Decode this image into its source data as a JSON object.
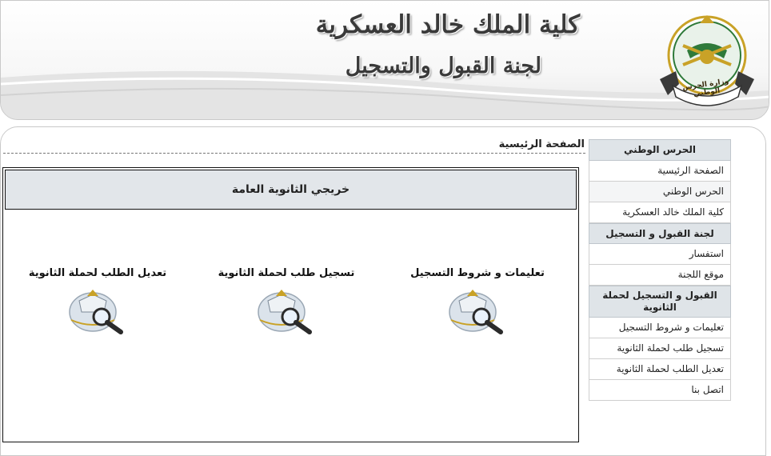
{
  "header": {
    "college_name": "كلية الملك خالد العسكرية",
    "committee_name": "لجنة القبول والتسجيل",
    "emblem_label": "وزارة الحرس الوطني"
  },
  "breadcrumb": "الصفحة الرئيسية",
  "sidebar": {
    "groups": [
      {
        "title": "الحرس الوطني",
        "items": [
          "الصفحة الرئيسية",
          "الحرس الوطني",
          "كلية الملك خالد العسكرية"
        ]
      },
      {
        "title": "لجنة القبول و التسجيل",
        "items": [
          "استفسار",
          "موقع اللجنة"
        ]
      },
      {
        "title": "القبول و التسجيل لحملة الثانوية",
        "items": [
          "تعليمات و شروط التسجيل",
          "تسجيل طلب لحملة الثانوية",
          "تعديل الطلب لحملة الثانوية",
          "اتصل بنا"
        ]
      }
    ]
  },
  "content": {
    "title": "خريجي الثانوية العامة",
    "links": [
      {
        "label": "تعليمات و شروط التسجيل",
        "icon": "search-document-icon"
      },
      {
        "label": "تسجيل طلب لحملة الثانوية",
        "icon": "search-document-icon"
      },
      {
        "label": "تعديل الطلب لحملة الثانوية",
        "icon": "search-document-icon"
      }
    ]
  },
  "colors": {
    "sidebar_header_bg": "#dfe4e8",
    "content_title_bg": "#e2e6ea",
    "emblem_green": "#2f7a3a",
    "emblem_gold": "#c9a227"
  }
}
